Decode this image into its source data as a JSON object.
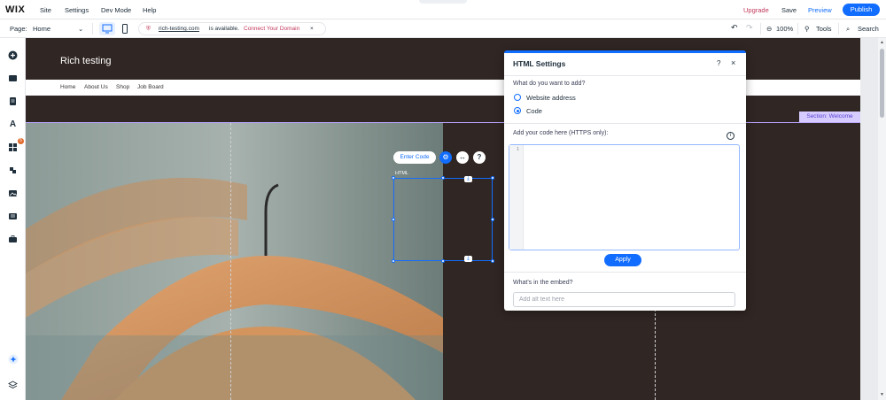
{
  "topbar": {
    "logo": "WIX",
    "menu": [
      "Site",
      "Settings",
      "Dev Mode",
      "Help"
    ],
    "upgrade": "Upgrade",
    "save": "Save",
    "preview": "Preview",
    "publish": "Publish"
  },
  "toolbar": {
    "page_label": "Page:",
    "page_value": "Home",
    "url_domain": "rich-testing.com",
    "url_available": "is available.",
    "url_connect": "Connect Your Domain",
    "zoom": "100%",
    "tools": "Tools",
    "search": "Search"
  },
  "sidebar": {
    "icons": [
      "add-icon",
      "sections-icon",
      "pages-icon",
      "design-icon",
      "apps-icon",
      "business-icon",
      "media-icon",
      "cms-icon",
      "portfolio-icon"
    ],
    "apps_badge": "5"
  },
  "site": {
    "title": "Rich testing",
    "nav": [
      "Home",
      "About Us",
      "Shop",
      "Job Board"
    ],
    "section_tag": "Section: Welcome",
    "html_label": "HTML",
    "enter_code": "Enter Code"
  },
  "panel": {
    "title": "HTML Settings",
    "help": "?",
    "question": "What do you want to add?",
    "option_website": "Website address",
    "option_code": "Code",
    "selected_option": "Code",
    "code_label": "Add your code here (HTTPS only):",
    "line_number": "1",
    "apply": "Apply",
    "embed_label": "What's in the embed?",
    "alt_placeholder": "Add alt text here"
  },
  "colors": {
    "accent": "#116dff",
    "upgrade": "#c2395c",
    "site_bg": "#302623",
    "section_tag_bg": "#d6ccff"
  }
}
